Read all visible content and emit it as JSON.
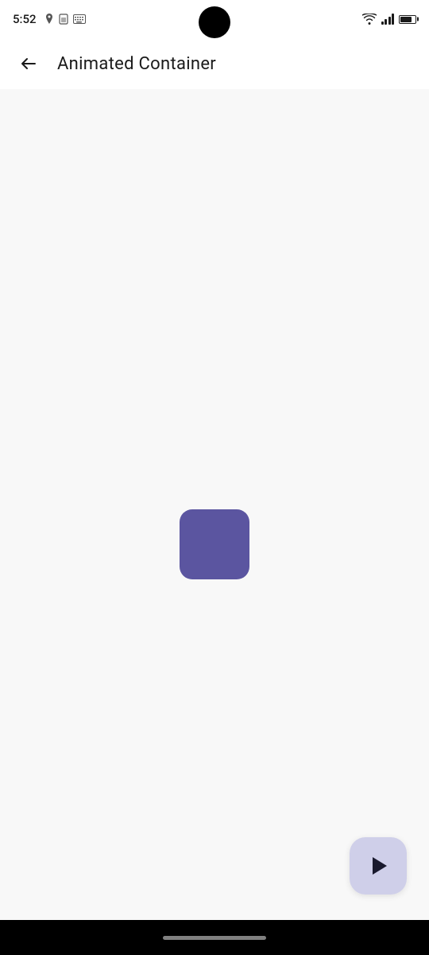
{
  "status_bar": {
    "time": "5:52",
    "icons_left": [
      "location-icon",
      "sim-icon",
      "keyboard-icon"
    ],
    "icons_right": [
      "wifi-icon",
      "signal-icon",
      "battery-icon"
    ]
  },
  "app_bar": {
    "back_label": "←",
    "title": "Animated Container"
  },
  "main": {
    "animated_box": {
      "color": "#5b55a0",
      "border_radius": "16px"
    }
  },
  "play_fab": {
    "label": "▶"
  },
  "bottom": {
    "home_indicator": ""
  }
}
